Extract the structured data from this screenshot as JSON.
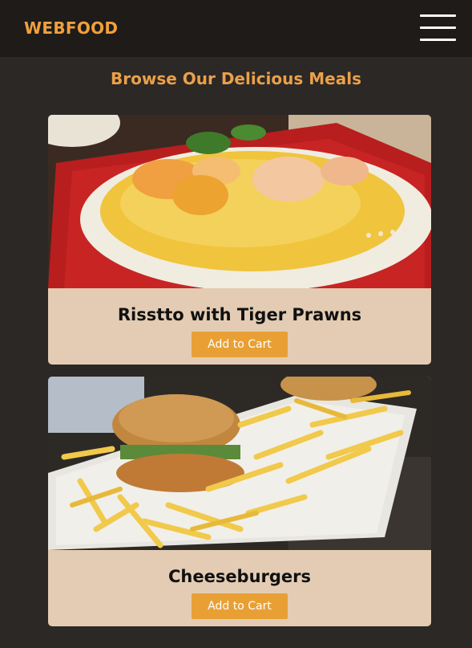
{
  "header": {
    "brand": "WEBFOOD",
    "menu_icon": "hamburger-menu-icon"
  },
  "main": {
    "heading": "Browse Our Delicious Meals",
    "meals": [
      {
        "title": "Risstto with Tiger Prawns",
        "button_label": "Add to Cart"
      },
      {
        "title": "Cheeseburgers",
        "button_label": "Add to Cart"
      }
    ]
  },
  "colors": {
    "background": "#2b2825",
    "header": "#1e1b19",
    "accent": "#f0a03c",
    "card": "#e3ccb3",
    "button": "#e8a035"
  }
}
